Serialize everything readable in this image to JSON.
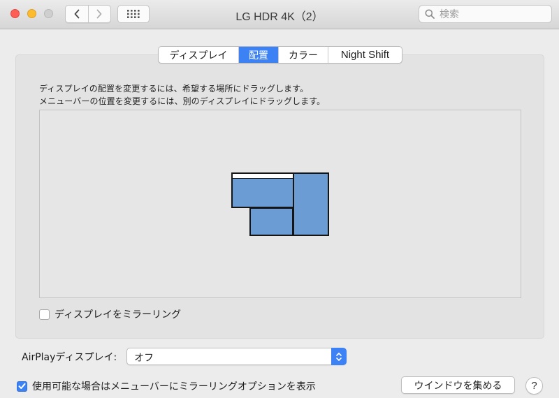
{
  "window": {
    "title": "LG HDR 4K（2）",
    "search_placeholder": "検索"
  },
  "icons": {
    "back": "chevron-left-icon",
    "forward": "chevron-right-icon",
    "show_all": "grid-icon",
    "search": "magnifier-icon",
    "checkmark": "checkmark-icon",
    "popup_arrows": "up-down-chevron-icon"
  },
  "tabs": [
    {
      "label": "ディスプレイ",
      "active": false
    },
    {
      "label": "配置",
      "active": true
    },
    {
      "label": "カラー",
      "active": false
    },
    {
      "label": "Night Shift",
      "active": false
    }
  ],
  "arrangement": {
    "description_line1": "ディスプレイの配置を変更するには、希望する場所にドラッグします。",
    "description_line2": "メニューバーの位置を変更するには、別のディスプレイにドラッグします。",
    "mirror_label": "ディスプレイをミラーリング",
    "mirror_checked": false,
    "display_color": "#6b9cd4"
  },
  "airplay": {
    "label": "AirPlayディスプレイ:",
    "value": "オフ"
  },
  "footer": {
    "menu_option_label": "使用可能な場合はメニューバーにミラーリングオプションを表示",
    "menu_option_checked": true,
    "gather_button": "ウインドウを集める",
    "help_button": "?"
  },
  "colors": {
    "accent": "#3c82f5",
    "close": "#fd5f57",
    "minimize": "#fdbc2e",
    "zoom_inactive": "#cfcfcf"
  }
}
